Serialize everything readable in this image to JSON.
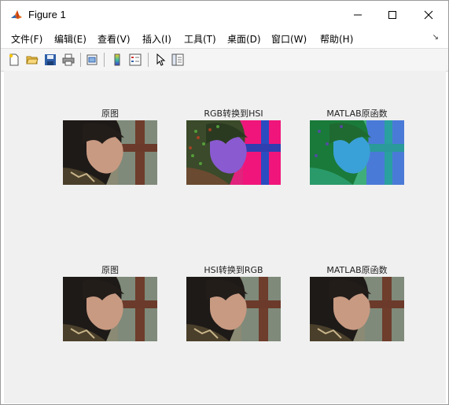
{
  "window": {
    "title": "Figure 1"
  },
  "menu": {
    "items": [
      "文件(F)",
      "编辑(E)",
      "查看(V)",
      "插入(I)",
      "工具(T)",
      "桌面(D)",
      "窗口(W)",
      "帮助(H)"
    ]
  },
  "toolbar": {
    "icons": [
      "new-file-icon",
      "open-folder-icon",
      "save-icon",
      "print-icon",
      "link-plot-icon",
      "colorbar-icon",
      "legend-icon",
      "pointer-icon",
      "property-editor-icon"
    ]
  },
  "figure": {
    "panels": [
      {
        "title": "原图",
        "variant": "original"
      },
      {
        "title": "RGB转换到HSI",
        "variant": "hsi"
      },
      {
        "title": "MATLAB原函数",
        "variant": "hsv"
      },
      {
        "title": "原图",
        "variant": "original"
      },
      {
        "title": "HSI转换到RGB",
        "variant": "original"
      },
      {
        "title": "MATLAB原函数",
        "variant": "original"
      }
    ]
  },
  "colors": {
    "figure_bg": "#f0f0f0",
    "window_bg": "#ffffff"
  }
}
